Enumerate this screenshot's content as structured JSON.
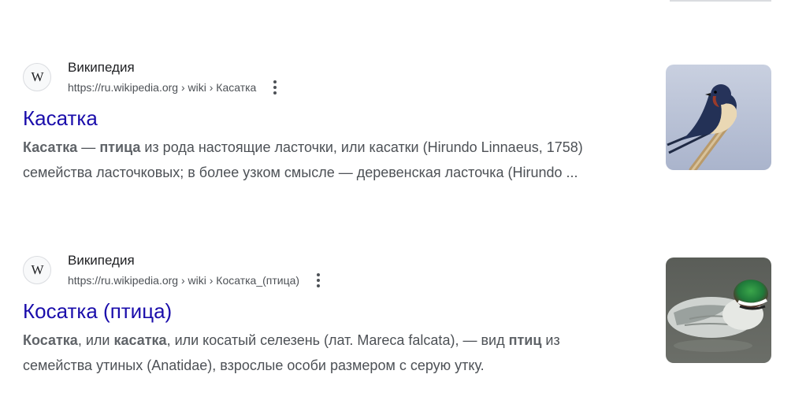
{
  "results": [
    {
      "site_name": "Википедия",
      "favicon": "W",
      "url": "https://ru.wikipedia.org › wiki › Касатка",
      "title": "Касатка",
      "snippet": {
        "b1": "Касатка",
        "t1": " — ",
        "b2": "птица",
        "t2": " из рода настоящие ласточки, или касатки (Hirundo Linnaeus, 1758) семейства ласточковых; в более узком смысле — деревенская ласточка (Hirundo ..."
      },
      "thumbnail_icon": "swallow-bird-thumbnail"
    },
    {
      "site_name": "Википедия",
      "favicon": "W",
      "url": "https://ru.wikipedia.org › wiki › Косатка_(птица)",
      "title": "Косатка (птица)",
      "snippet": {
        "b1": "Косатка",
        "t1": ", или ",
        "b2": "касатка",
        "t2": ", или косатый селезень (лат. Mareca falcata), — вид ",
        "b3": "птиц",
        "t3": " из семейства утиных (Anatidae), взрослые особи размером с серую утку."
      },
      "thumbnail_icon": "falcated-duck-thumbnail"
    }
  ],
  "colors": {
    "link": "#1a0dab",
    "text": "#202124",
    "snippet": "#4d5156"
  }
}
